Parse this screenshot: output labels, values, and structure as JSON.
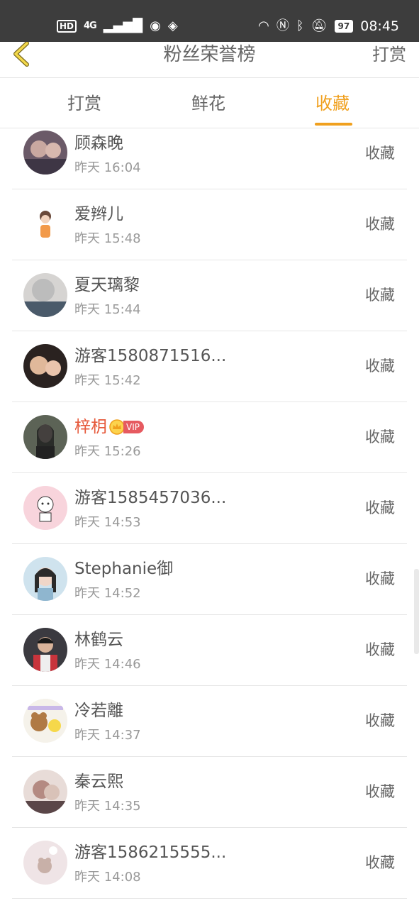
{
  "status_bar": {
    "hd": "HD",
    "network": "4G",
    "battery": "97",
    "time": "08:45"
  },
  "header": {
    "title": "粉丝荣誉榜",
    "action": "打赏"
  },
  "tabs": [
    {
      "label": "打赏",
      "active": false
    },
    {
      "label": "鲜花",
      "active": false
    },
    {
      "label": "收藏",
      "active": true
    }
  ],
  "accent_color": "#f0a01e",
  "vip_color": "#e65a3c",
  "list": [
    {
      "name": "顾森晚",
      "time": "昨天 16:04",
      "action": "收藏",
      "vip": false
    },
    {
      "name": "爱辫儿",
      "time": "昨天 15:48",
      "action": "收藏",
      "vip": false
    },
    {
      "name": "夏天璃黎",
      "time": "昨天 15:44",
      "action": "收藏",
      "vip": false
    },
    {
      "name": "游客1580871516...",
      "time": "昨天 15:42",
      "action": "收藏",
      "vip": false
    },
    {
      "name": "梓枂",
      "time": "昨天 15:26",
      "action": "收藏",
      "vip": true,
      "vip_label": "VIP"
    },
    {
      "name": "游客1585457036...",
      "time": "昨天 14:53",
      "action": "收藏",
      "vip": false
    },
    {
      "name": "Stephanie御",
      "time": "昨天 14:52",
      "action": "收藏",
      "vip": false
    },
    {
      "name": "林鹤云",
      "time": "昨天 14:46",
      "action": "收藏",
      "vip": false
    },
    {
      "name": "冷若離",
      "time": "昨天 14:37",
      "action": "收藏",
      "vip": false
    },
    {
      "name": "秦云熙",
      "time": "昨天 14:35",
      "action": "收藏",
      "vip": false
    },
    {
      "name": "游客1586215555...",
      "time": "昨天 14:08",
      "action": "收藏",
      "vip": false
    }
  ]
}
